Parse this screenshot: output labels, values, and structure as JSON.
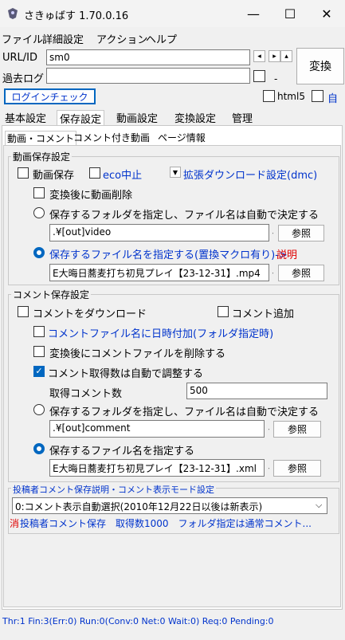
{
  "window": {
    "title": "さきゅばす 1.70.0.16",
    "minimize": "—",
    "maximize": "☐",
    "close": "✕"
  },
  "menu": [
    "ファイル",
    "詳細設定",
    "アクション",
    "ヘルプ"
  ],
  "urlid": {
    "label": "URL/ID",
    "value": "sm0"
  },
  "pastlog": {
    "label": "過去ログ",
    "value": "",
    "suffix": "-"
  },
  "convert_button": "変換",
  "login_button": "ログインチェック",
  "html5_label": "html5",
  "auto_label": "自",
  "tabs": [
    "基本設定",
    "保存設定",
    "動画設定",
    "変換設定",
    "管理"
  ],
  "subtabs": [
    "動画・コメント",
    "コメント付き動画",
    "ページ情報"
  ],
  "video_save": {
    "group_label": "動画保存設定",
    "save_video": "動画保存",
    "eco_stop": "eco中止",
    "extended_dl": "拡張ダウンロード設定(dmc)",
    "delete_after": "変換後に動画削除",
    "folder_radio": "保存するフォルダを指定し、ファイル名は自動で決定する",
    "folder_value": ".¥[out]video",
    "browse": "参照",
    "file_radio": "保存するファイル名を指定する(置換マクロ有り)->",
    "explain": "説明",
    "file_value": "E大晦日蕎麦打ち初見プレイ【23-12-31】.mp4"
  },
  "comment_save": {
    "group_label": "コメント保存設定",
    "download": "コメントをダウンロード",
    "add": "コメント追加",
    "datetime": "コメントファイル名に日時付加(フォルダ指定時)",
    "delete_after": "変換後にコメントファイルを削除する",
    "auto_adjust": "コメント取得数は自動で調整する",
    "count_label": "取得コメント数",
    "count_value": "500",
    "folder_radio": "保存するフォルダを指定し、ファイル名は自動で決定する",
    "folder_value": ".¥[out]comment",
    "browse": "参照",
    "file_radio": "保存するファイル名を指定する",
    "file_value": "E大晦日蕎麦打ち初見プレイ【23-12-31】.xml"
  },
  "poster": {
    "group_label": "投稿者コメント保存説明・コメント表示モード設定",
    "select_value": "0:コメント表示自動選択(2010年12月22日以後は新表示)",
    "info_red": "消",
    "info_blue": "投稿者コメント保存　取得数1000　フォルダ指定は通常コメント..."
  },
  "status": "Thr:1  Fin:3(Err:0)  Run:0(Conv:0  Net:0  Wait:0)  Req:0  Pending:0"
}
